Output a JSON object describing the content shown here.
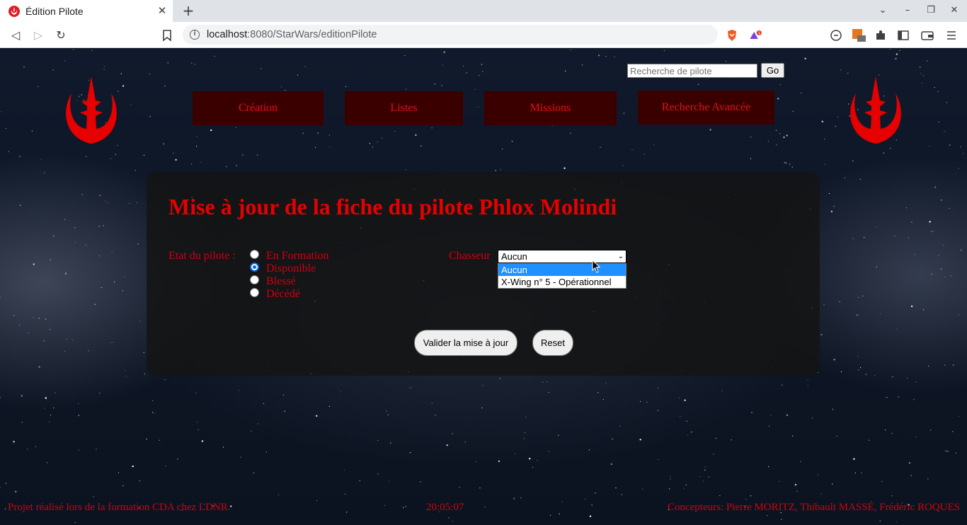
{
  "browser": {
    "tab_title": "Édition Pilote",
    "new_tab_label": "+",
    "url_host": "localhost",
    "url_rest": ":8080/StarWars/editionPilote",
    "brave_badge_count": "1"
  },
  "header": {
    "search_placeholder": "Recherche de pilote",
    "search_button": "Go",
    "nav": [
      "Création",
      "Listes",
      "Missions",
      "Recherche Avancée"
    ]
  },
  "form": {
    "title": "Mise à jour de la fiche du pilote Phlox Molindi",
    "etat_label": "Etat du pilote :",
    "etat_options": [
      {
        "label": "En Formation",
        "checked": false
      },
      {
        "label": "Disponible",
        "checked": true
      },
      {
        "label": "Blessé",
        "checked": false
      },
      {
        "label": "Décédé",
        "checked": false
      }
    ],
    "chasseur_label": "Chasseur",
    "chasseur_selected": "Aucun",
    "chasseur_options": [
      "Aucun",
      "X-Wing n° 5 - Opérationnel"
    ],
    "submit_label": "Valider la mise à jour",
    "reset_label": "Reset"
  },
  "footer": {
    "left": "Projet réalisé lors de la formation CDA chez LDNR.",
    "clock": "20:05:07",
    "right": "Concepteurs: Pierre MORITZ, Thibault MASSÉ, Frédéric ROQUES"
  },
  "colors": {
    "accent_red": "#e60000",
    "nav_bg": "#3a0000",
    "highlight_blue": "#1e90ff"
  }
}
